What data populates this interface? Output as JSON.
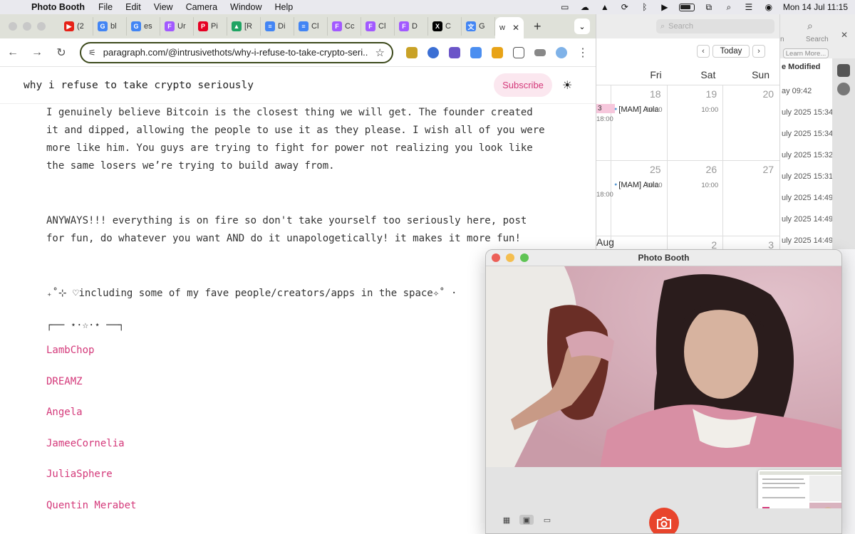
{
  "menubar": {
    "app_name": "Photo Booth",
    "menus": [
      "File",
      "Edit",
      "View",
      "Camera",
      "Window",
      "Help"
    ],
    "clock": "Mon 14 Jul  11:15"
  },
  "browser": {
    "tabs": [
      {
        "label": "(2",
        "icon": "youtube-icon",
        "color": "#e62117",
        "glyph": "▶"
      },
      {
        "label": "bl",
        "icon": "google-icon",
        "color": "#4285f4",
        "glyph": "G"
      },
      {
        "label": "es",
        "icon": "google-icon",
        "color": "#4285f4",
        "glyph": "G"
      },
      {
        "label": "Ur",
        "icon": "figma-icon",
        "color": "#a259ff",
        "glyph": "F"
      },
      {
        "label": "Pi",
        "icon": "pinterest-icon",
        "color": "#e60023",
        "glyph": "P"
      },
      {
        "label": "[R",
        "icon": "google-drive-icon",
        "color": "#1fa463",
        "glyph": "▲"
      },
      {
        "label": "Di",
        "icon": "google-docs-icon",
        "color": "#4285f4",
        "glyph": "≡"
      },
      {
        "label": "Cl",
        "icon": "google-docs-icon",
        "color": "#4285f4",
        "glyph": "≡"
      },
      {
        "label": "Cc",
        "icon": "figma-icon",
        "color": "#a259ff",
        "glyph": "F"
      },
      {
        "label": "Cl",
        "icon": "figma-icon",
        "color": "#a259ff",
        "glyph": "F"
      },
      {
        "label": "D",
        "icon": "figma-icon",
        "color": "#a259ff",
        "glyph": "F"
      },
      {
        "label": "C",
        "icon": "x-icon",
        "color": "#000000",
        "glyph": "X"
      },
      {
        "label": "G",
        "icon": "google-translate-icon",
        "color": "#4285f4",
        "glyph": "文"
      }
    ],
    "active_tab_label": "w",
    "url": "paragraph.com/@intrusivethots/why-i-refuse-to-take-crypto-seri..."
  },
  "page": {
    "title": "why i refuse to take crypto seriously",
    "subscribe_label": "Subscribe",
    "paragraph_1": "I genuinely believe Bitcoin is the closest thing we will get. The founder created it and dipped, allowing the people to use it as they please. I wish all of you were more like him. You guys are trying to fight for power not realizing you look like the same losers we’re trying to build away from.",
    "paragraph_2": "ANYWAYS!!! everything is on fire so don't take yourself too seriously here, post for fun, do whatever you want AND do it unapologetically! it makes it more fun!",
    "list_heading": "₊˚⊹ ♡including some of my fave people/creators/apps in the space✧˚ ·",
    "divider": "┌── ⋆⋅☆⋅⋆ ──┐",
    "links": [
      "LambChop",
      "DREAMZ",
      "Angela",
      "JameeCornelia",
      "JuliaSphere",
      "Quentin Merabet"
    ]
  },
  "calendar": {
    "search_placeholder": "Search",
    "today_label": "Today",
    "days": [
      "Fri",
      "Sat",
      "Sun"
    ],
    "rows": [
      {
        "prev": "3",
        "prev_time": "18:00",
        "fri": "18",
        "sat": "19",
        "sun": "20",
        "event": "[MAM] Aula",
        "event_time": "10:00"
      },
      {
        "prev": "",
        "prev_time": "18:00",
        "fri": "25",
        "sat": "26",
        "sun": "27",
        "event": "[MAM] Aula",
        "event_time": "10:00"
      },
      {
        "prev": "Aug",
        "prev_time": "",
        "fri": "",
        "sat": "2",
        "sun": "3",
        "event": "",
        "event_time": ""
      }
    ]
  },
  "finder": {
    "search_label": "Search",
    "col_label": "n",
    "learn_more": "Learn More...",
    "column_header": "e Modified",
    "rows": [
      "ay 09:42",
      "uly 2025 15:34",
      "uly 2025 15:34",
      "uly 2025 15:32",
      "uly 2025 15:31",
      "uly 2025 14:49",
      "uly 2025 14:49",
      "uly 2025 14:49"
    ]
  },
  "photobooth": {
    "title": "Photo Booth"
  },
  "colors": {
    "accent_pink": "#d4397a",
    "subscribe_bg": "#fbe7ef",
    "shutter_red": "#e8442c"
  }
}
